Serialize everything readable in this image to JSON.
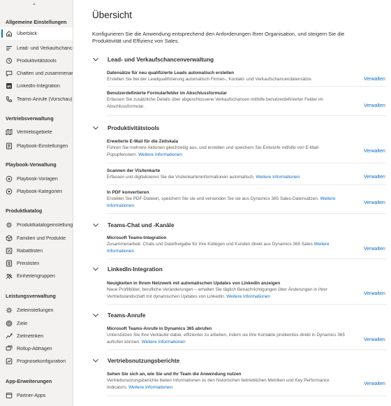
{
  "sidebar": {
    "groups": [
      {
        "title": "Allgemeine Einstellungen",
        "items": [
          {
            "label": "Überblick",
            "icon": "home-icon",
            "active": true
          },
          {
            "label": "Lead- und Verkaufschancen",
            "icon": "sales-process-icon"
          },
          {
            "label": "Produktivitätstools",
            "icon": "productivity-icon"
          },
          {
            "label": "Chatten und zusammenarbeiten",
            "icon": "chat-icon"
          },
          {
            "label": "LinkedIn-Integration",
            "icon": "linkedin-icon"
          },
          {
            "label": "Teams-Anrufe (Vorschau)",
            "icon": "teams-call-icon"
          }
        ]
      },
      {
        "title": "Vertriebsverwaltung",
        "items": [
          {
            "label": "Vertriebsgebiete",
            "icon": "territory-icon"
          },
          {
            "label": "Playbook-Einstellungen",
            "icon": "playbook-settings-icon"
          }
        ]
      },
      {
        "title": "Playbook-Verwaltung",
        "items": [
          {
            "label": "Playbook-Vorlagen",
            "icon": "playbook-template-icon"
          },
          {
            "label": "Playbook-Kategorien",
            "icon": "playbook-category-icon"
          }
        ]
      },
      {
        "title": "Produktkatalog",
        "items": [
          {
            "label": "Produktkatalogeinstellungen",
            "icon": "catalog-settings-icon"
          },
          {
            "label": "Familien und Produkte",
            "icon": "products-icon"
          },
          {
            "label": "Rabattlisten",
            "icon": "discount-icon"
          },
          {
            "label": "Preislisten",
            "icon": "price-list-icon"
          },
          {
            "label": "Einheitengruppen",
            "icon": "unit-groups-icon"
          }
        ]
      },
      {
        "title": "Leistungsverwaltung",
        "items": [
          {
            "label": "Zieleinstellungen",
            "icon": "goal-settings-icon"
          },
          {
            "label": "Ziele",
            "icon": "goals-icon"
          },
          {
            "label": "Zielmetriken",
            "icon": "goal-metrics-icon"
          },
          {
            "label": "Rollup-Abfragen",
            "icon": "rollup-queries-icon"
          },
          {
            "label": "Prognosekonfiguration",
            "icon": "forecast-config-icon"
          }
        ]
      },
      {
        "title": "App-Erweiterungen",
        "items": [
          {
            "label": "Partner-Apps",
            "icon": "partner-apps-icon"
          }
        ]
      }
    ]
  },
  "main": {
    "title": "Übersicht",
    "intro": "Konfigurieren Sie die Anwendung entsprechend den Anforderungen Ihrer Organisation, und steigern Sie die Produktivität und Effizienz von Sales.",
    "manage_label": "Verwalten",
    "sections": [
      {
        "title": "Lead- und Verkaufschancenverwaltung",
        "items": [
          {
            "title": "Datensätze für neu qualifizierte Leads automatisch erstellen",
            "desc": "Erstellen Sie bei der Leadqualifizierung automatisch Firmen-, Kontakt- und Verkaufschancendatensätze.",
            "link": ""
          },
          {
            "title": "Benutzerdefinierte Formularfelder im Abschlussformular",
            "desc": "Erfassen Sie zusätzliche Details über abgeschlossene Verkaufschancen mithilfe benutzerdefinierter Felder im Abschlussformular.",
            "link": ""
          }
        ]
      },
      {
        "title": "Produktivitätstools",
        "items": [
          {
            "title": "Erweiterte E-Mail für die Zeitskala",
            "desc": "Führen Sie mehrere Aktionen gleichzeitig aus, und erstellen und speichern Sie Entwürfe mithilfe von E-Mail-Popupfenstern.",
            "link": "Weitere Informationen"
          },
          {
            "title": "Scannen der Visitenkarte",
            "desc": "Erfassen und digitalisieren Sie die Visitenkarteninformationen automatisch.",
            "link": "Weitere Informationen"
          },
          {
            "title": "In PDF konvertieren",
            "desc": "Erstellen Sie PDF-Dateien, speichern Sie sie und versenden Sie sie aus Dynamics 365 Sales-Datensätzen.",
            "link": "Weitere Informationen"
          }
        ]
      },
      {
        "title": "Teams-Chat und -Kanäle",
        "items": [
          {
            "title": "Microsoft Teams-Integration",
            "desc": "Zusammenarbeit. Chats und Dateifreigabe für Ihre Kollegen und Kunden direkt aus Dynamics 365 Sales",
            "link": "Weitere Informationen"
          }
        ]
      },
      {
        "title": "LinkedIn-Integration",
        "items": [
          {
            "title": "Neuigkeiten in Ihrem Netzwerk mit automatischen Updates von LinkedIn anzeigen",
            "desc": "Neue Profilbilder, berufliche Veränderungen – erhalten Sie täglich Benachrichtigungen über Änderungen in ihrer Vertriebslandschaft mit dynamischen Updates von LinkedIn.",
            "link": "Weitere Informationen"
          }
        ]
      },
      {
        "title": "Teams-Anrufe",
        "items": [
          {
            "title": "Microsoft Teams-Anrufe in Dynamics 365 abrufen",
            "desc": "Unterstützen Sie Ihre Verkäufer dabei, effizienter zu arbeiten, indem sie ihre Kontakte problemlos direkt in Dynamics 365 aufrufen können.",
            "link": "Weitere Informationen"
          }
        ]
      },
      {
        "title": "Vertriebsnutzungsberichte",
        "items": [
          {
            "title": "Sehen Sie sich an, wie Sie und Ihr Team die Anwendung nutzen",
            "desc": "Vertriebsnutzungsberichte bieten Informationen zu den historischen betrieblichen Metriken und Key Performance Indicators.",
            "link": "Weitere Informationen"
          }
        ]
      }
    ]
  }
}
